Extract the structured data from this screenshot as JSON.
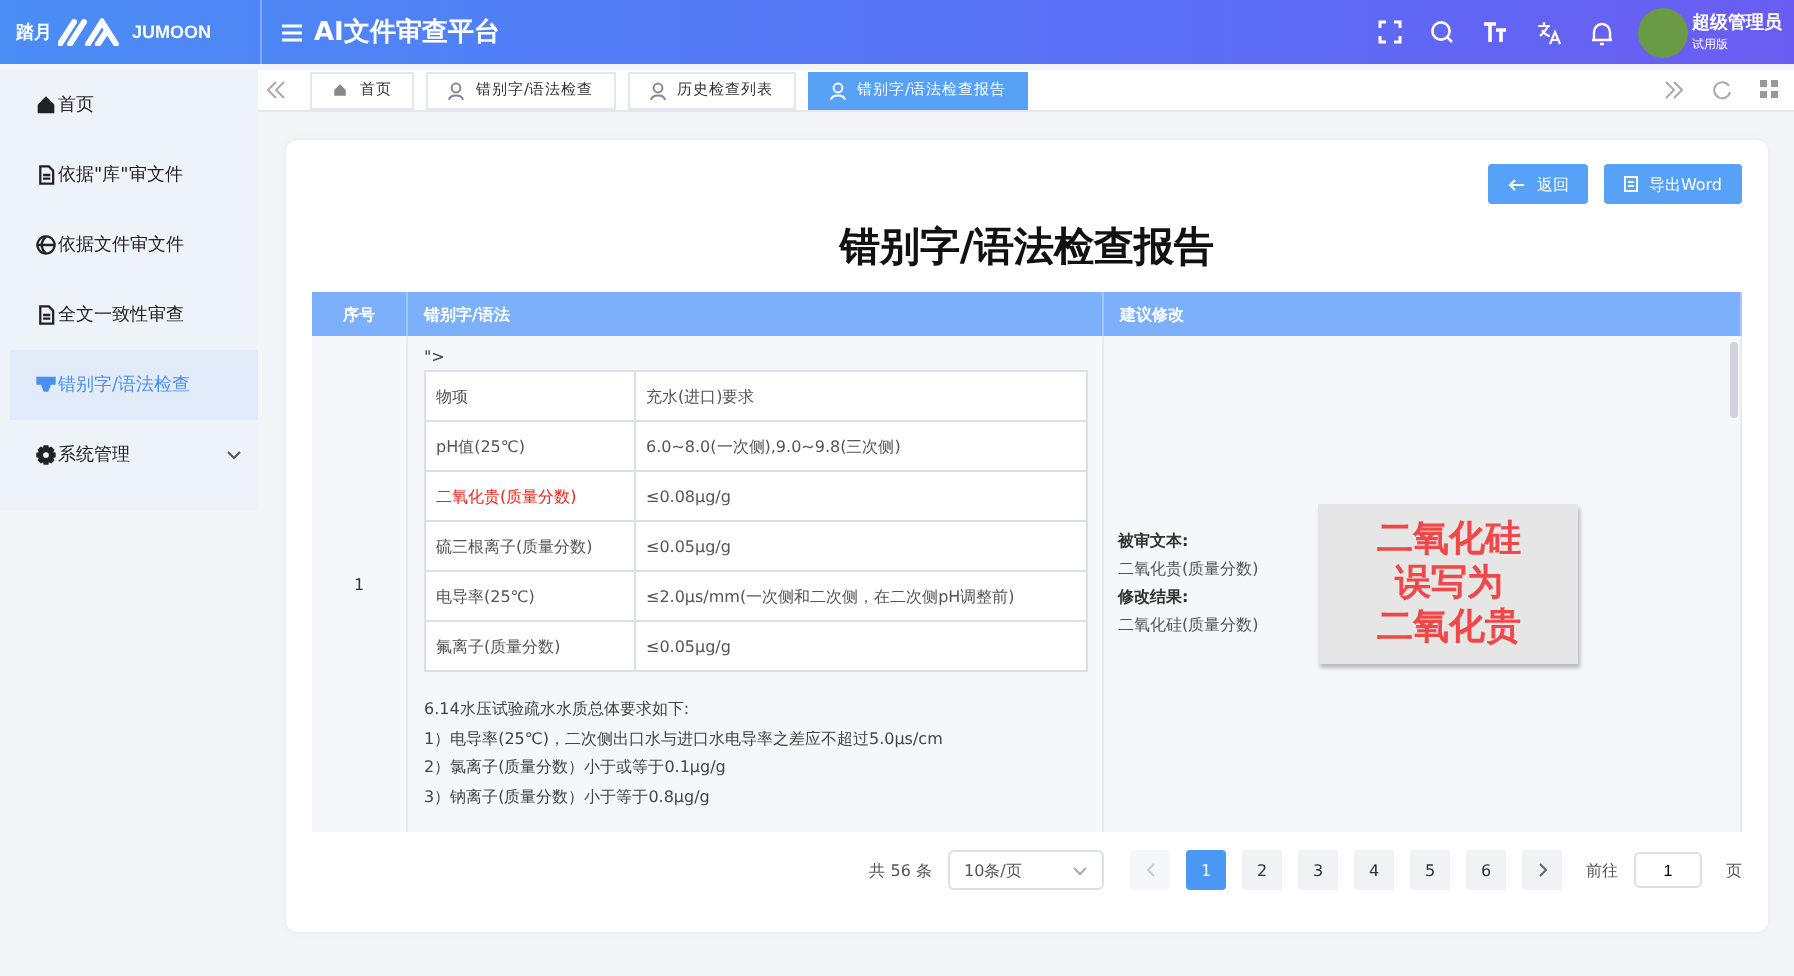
{
  "header": {
    "logo_cn": "踏月",
    "logo_en": "JUMOON",
    "title": "AI文件审查平台",
    "user": {
      "name": "超级管理员",
      "role": "试用版"
    }
  },
  "sidebar": {
    "items": [
      {
        "label": "首页",
        "kind": "home",
        "selected": false,
        "expandable": false
      },
      {
        "label": "依据\"库\"审文件",
        "kind": "document",
        "selected": false,
        "expandable": false
      },
      {
        "label": "依据文件审文件",
        "kind": "globe",
        "selected": false,
        "expandable": false
      },
      {
        "label": "全文一致性审查",
        "kind": "document",
        "selected": false,
        "expandable": false
      },
      {
        "label": "错别字/语法检查",
        "kind": "filter",
        "selected": true,
        "expandable": false
      },
      {
        "label": "系统管理",
        "kind": "settings",
        "selected": false,
        "expandable": true
      }
    ]
  },
  "tabs": [
    {
      "label": "首页",
      "kind": "home",
      "selected": false
    },
    {
      "label": "错别字/语法检查",
      "kind": "page",
      "selected": false
    },
    {
      "label": "历史检查列表",
      "kind": "page",
      "selected": false
    },
    {
      "label": "错别字/语法检查报告",
      "kind": "page",
      "selected": true
    }
  ],
  "actions": [
    {
      "label": "返回",
      "kind": "back"
    },
    {
      "label": "导出Word",
      "kind": "export"
    }
  ],
  "report_title": "错别字/语法检查报告",
  "table": {
    "columns": [
      "序号",
      "错别字/语法",
      "建议修改"
    ],
    "rows": [
      {
        "index": "1",
        "prefix": "\">",
        "inner_rows": [
          {
            "cells": [
              "物项",
              "充水(进口)要求"
            ],
            "error": false
          },
          {
            "cells": [
              "pH值(25℃)",
              "6.0~8.0(一次侧),9.0~9.8(三次侧)"
            ],
            "error": false
          },
          {
            "cells": [
              "二氧化贵(质量分数)",
              "≤0.08μg/g"
            ],
            "error": true
          },
          {
            "cells": [
              "硫三根离子(质量分数)",
              "≤0.05μg/g"
            ],
            "error": false
          },
          {
            "cells": [
              "电导率(25℃)",
              "≤2.0μs/mm(一次侧和二次侧，在二次侧pH调整前)"
            ],
            "error": false
          },
          {
            "cells": [
              "氟离子(质量分数)",
              "≤0.05μg/g"
            ],
            "error": false
          }
        ],
        "paragraphs": [
          "6.14水压试验疏水水质总体要求如下:",
          "1）电导率(25℃)，二次侧出口水与进口水电导率之差应不超过5.0μs/cm",
          "2）氯离子(质量分数）小于或等于0.1μg/g",
          "3）钠离子(质量分数）小于等于0.8μg/g"
        ],
        "suggestion": {
          "original_label": "被审文本:",
          "original": "二氧化贵(质量分数)",
          "result_label": "修改结果:",
          "result": "二氧化硅(质量分数)"
        },
        "annotation": [
          "二氧化硅",
          "误写为",
          "二氧化贵"
        ]
      }
    ]
  },
  "pagination": {
    "total": "共 56 条",
    "page_size": "10条/页",
    "pages": [
      {
        "label": "1",
        "selected": true
      },
      {
        "label": "2",
        "selected": false
      },
      {
        "label": "3",
        "selected": false
      },
      {
        "label": "4",
        "selected": false
      },
      {
        "label": "5",
        "selected": false
      },
      {
        "label": "6",
        "selected": false
      }
    ],
    "goto_label": "前往",
    "goto_value": "1",
    "goto_suffix": "页"
  }
}
